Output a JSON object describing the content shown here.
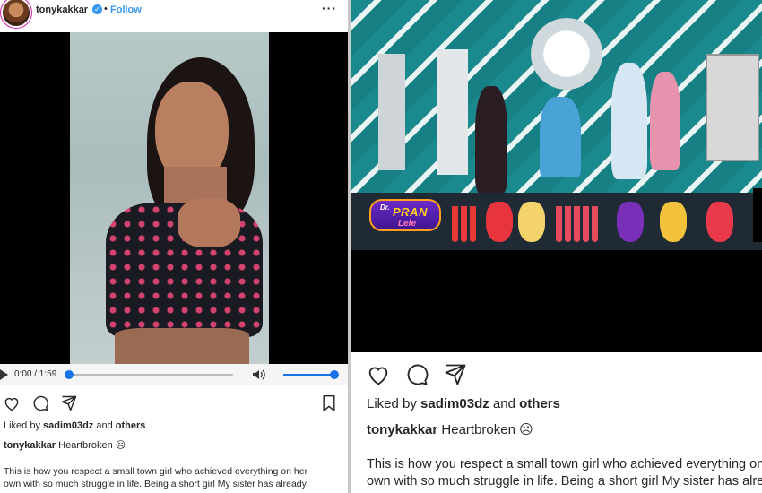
{
  "left_post": {
    "header": {
      "username": "tonykakkar",
      "verified_icon": "verified-badge-icon",
      "separator": "•",
      "follow_label": "Follow",
      "more_label": "···"
    },
    "video": {
      "current_time": "0:00 / 1:59",
      "progress": 0.0,
      "volume": 1.0
    },
    "actions": [
      "heart-icon",
      "comment-icon",
      "share-icon",
      "bookmark-icon"
    ],
    "liked_by_prefix": "Liked by",
    "liked_by_user": "sadim03dz",
    "liked_and": "and",
    "liked_others": "others",
    "caption_user": "tonykakkar",
    "caption_text": "Heartbroken ☹",
    "description_line1": "This is how you respect a small town girl who achieved everything on her",
    "description_line2": "own with so much struggle in life. Being a short girl My sister has already"
  },
  "right_post": {
    "video_logo": {
      "prefix": "Dr.",
      "name": "PRAN",
      "suffix": "Lele"
    },
    "actions": [
      "heart-icon",
      "comment-icon",
      "share-icon"
    ],
    "liked_by_prefix": "Liked by",
    "liked_by_user": "sadim03dz",
    "liked_and": "and",
    "liked_others": "others",
    "caption_user": "tonykakkar",
    "caption_text": "Heartbroken ☹",
    "description_line1": "This is how you respect a small town girl who achieved everything on her",
    "description_line2": "own with so much struggle in life. Being a short girl My sister has already"
  },
  "colors": {
    "accent": "#3897f0",
    "slider": "#1a73e8",
    "text": "#262626"
  }
}
